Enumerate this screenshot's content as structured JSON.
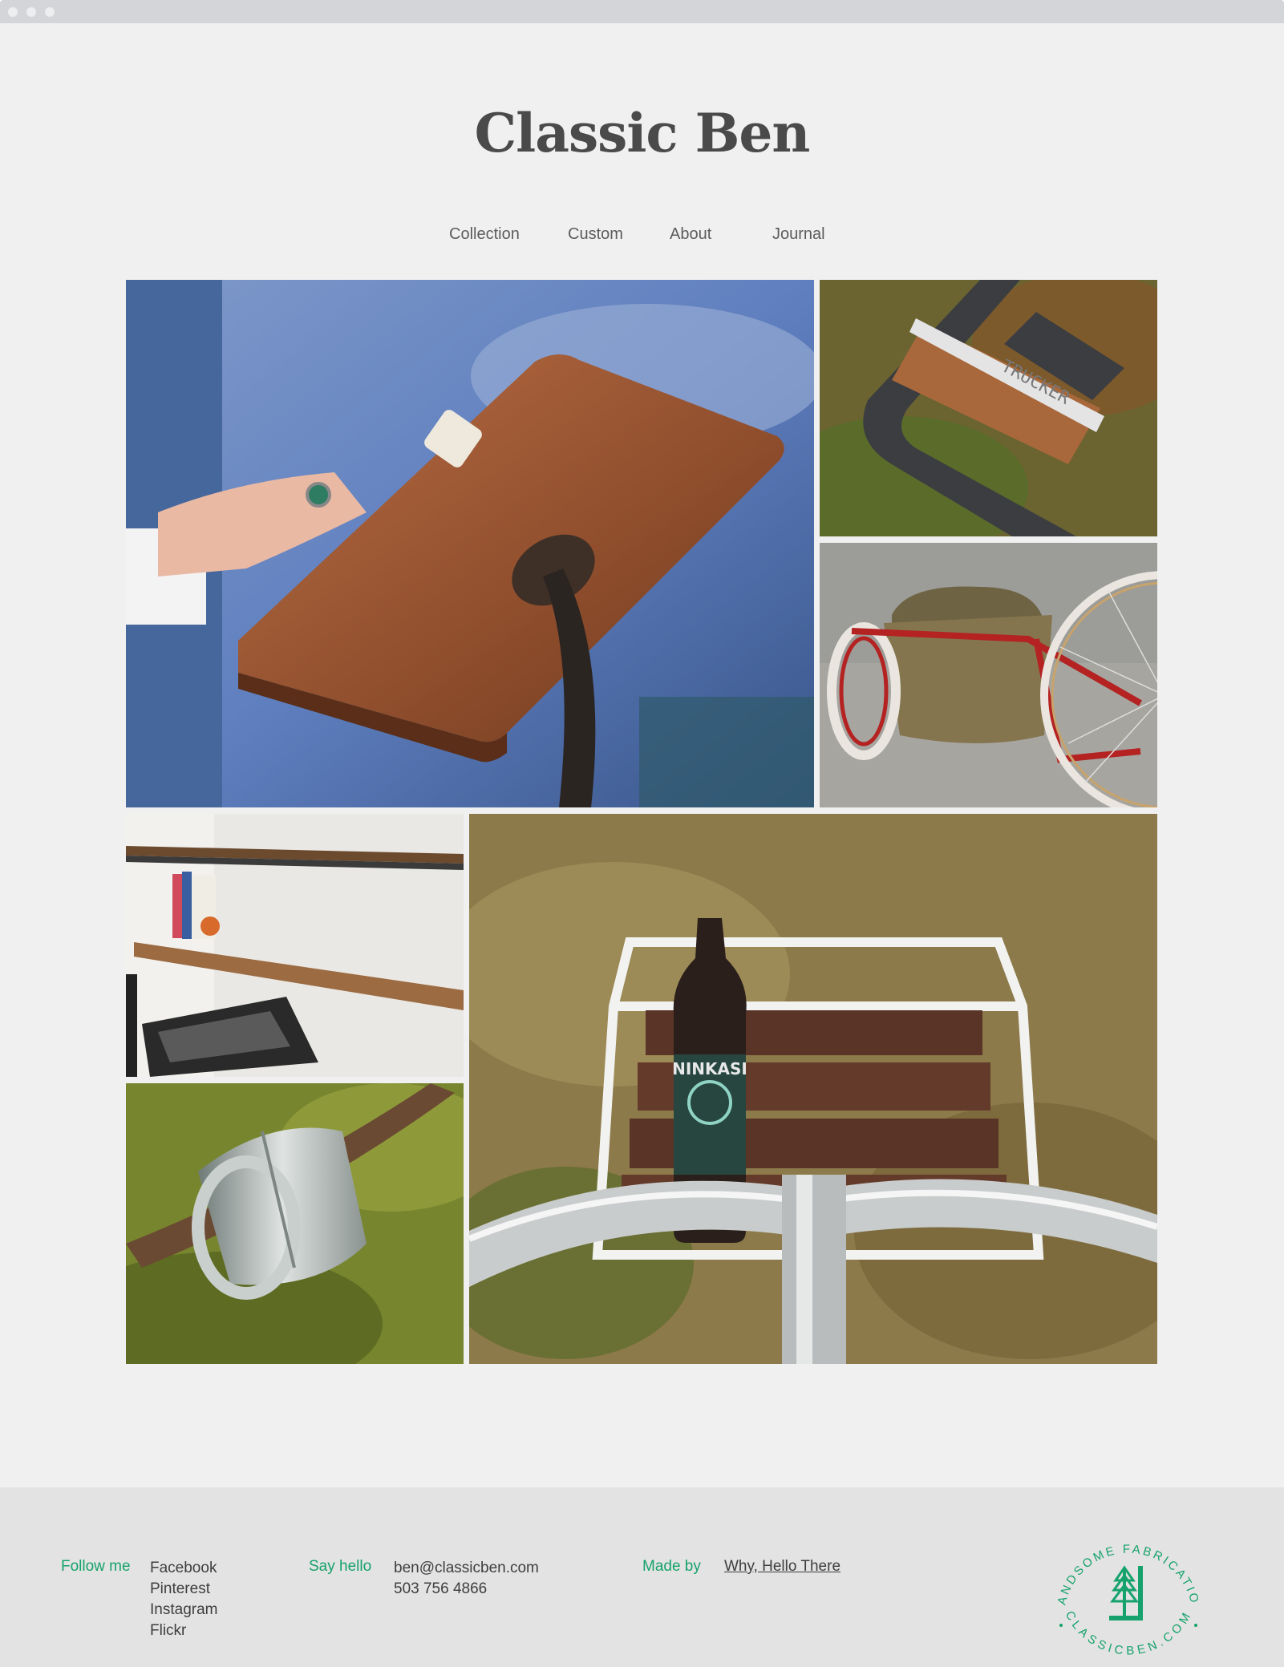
{
  "site": {
    "title": "Classic Ben"
  },
  "nav": {
    "items": [
      "Collection",
      "Custom",
      "About",
      "Journal"
    ]
  },
  "gallery": {
    "tiles": [
      {
        "icon": "wooden-ipad-stand-photo"
      },
      {
        "icon": "trucker-rack-nameplate-photo",
        "text": "TRUCKER"
      },
      {
        "icon": "bike-sidecar-trailer-photo"
      },
      {
        "icon": "wall-shelves-photo"
      },
      {
        "icon": "steel-ring-photo"
      },
      {
        "icon": "bike-front-rack-beer-photo",
        "text": "NINKASI"
      }
    ]
  },
  "footer": {
    "follow_label": "Follow me",
    "social": [
      "Facebook",
      "Pinterest",
      "Instagram",
      "Flickr"
    ],
    "hello_label": "Say hello",
    "email": "ben@classicben.com",
    "phone": "503 756 4866",
    "made_label": "Made by",
    "made_link": "Why, Hello There",
    "badge_top": "HANDSOME FABRICATION",
    "badge_bottom": "CLASSICBEN.COM"
  },
  "colors": {
    "accent": "#16a26c",
    "page_bg": "#f0f0f0",
    "footer_bg": "#e3e3e3",
    "text": "#4a4a4a"
  }
}
